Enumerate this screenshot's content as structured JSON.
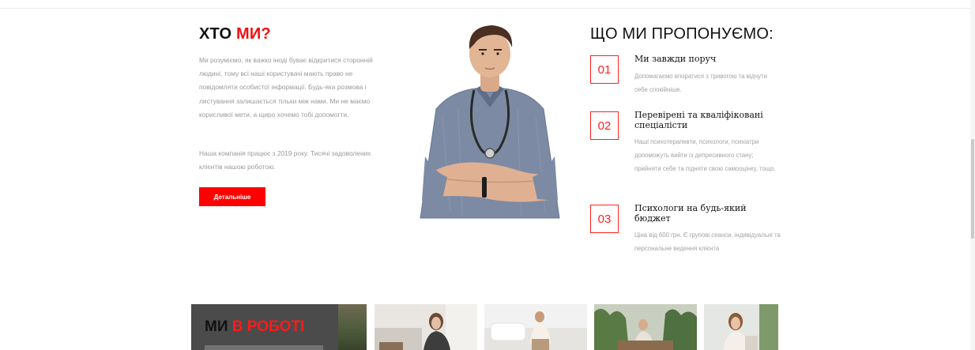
{
  "about": {
    "title_a": "ХТО ",
    "title_b": "МИ?",
    "paragraph1": "Ми розуміємо, як важко іноді буває відкритися сторонній людині, тому всі наші користувачі мають право не повідомляти особистої інформації. Будь-яка розмова і листування залишається тільки між нами. Ми не маємо корисливої мети, а щиро хочемо тобі допомогти.",
    "paragraph2": "Наша компанія працює з 2019 року. Тисячі задоволених клієнтів нашою роботою.",
    "button_label": "Детальніше"
  },
  "offer": {
    "title": "ЩО МИ ПРОПОНУЄМО:",
    "items": [
      {
        "num": "01",
        "title": "Ми завжди поруч",
        "desc": "Допомагаємо впоратися з тривогою та відчути себе спокійніше."
      },
      {
        "num": "02",
        "title": "Перевірені та кваліфіковані спеціалісти",
        "desc": "Наші психотерапевти, психологи, психіатри допоможуть вийти із депресивного стану; прийняти себе та підняти свою самооцінку, тощо."
      },
      {
        "num": "03",
        "title": "Психологи на будь-який бюджет",
        "desc": "Ціна від 600 грн. Є групові сеанси, індивідуальні та персональне ведення клієнта"
      }
    ]
  },
  "work": {
    "title_a": "МИ ",
    "title_b": "В РОБОТІ"
  },
  "colors": {
    "accent": "#ff0000",
    "text_muted": "#9a9a9a",
    "dark_card": "#4b4b4b"
  },
  "icons": {
    "doctor_photo": "doctor-photo",
    "gallery": [
      "photo-session-1",
      "photo-session-2",
      "photo-session-3",
      "photo-session-4"
    ]
  }
}
